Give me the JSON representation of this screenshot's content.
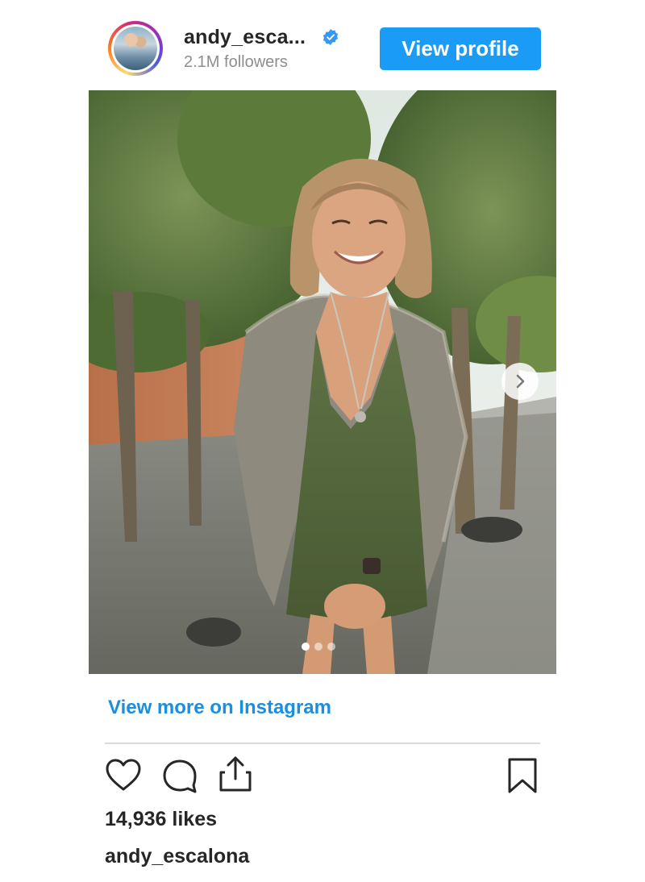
{
  "header": {
    "username": "andy_esca...",
    "followers": "2.1M followers",
    "view_profile_label": "View profile",
    "verified_color": "#3897f0",
    "avatar_icon": "profile-photo"
  },
  "post": {
    "carousel_total": 3,
    "carousel_active": 1,
    "next_icon": "chevron-right-icon"
  },
  "footer": {
    "view_more_label": "View more on Instagram",
    "actions": [
      "heart-icon",
      "comment-icon",
      "share-icon",
      "bookmark-icon"
    ],
    "likes": "14,936 likes",
    "author": "andy_escalona"
  },
  "colors": {
    "accent": "#1a9cf6",
    "link": "#1a8fe0",
    "text": "#262626",
    "muted": "#8e8e8e"
  }
}
